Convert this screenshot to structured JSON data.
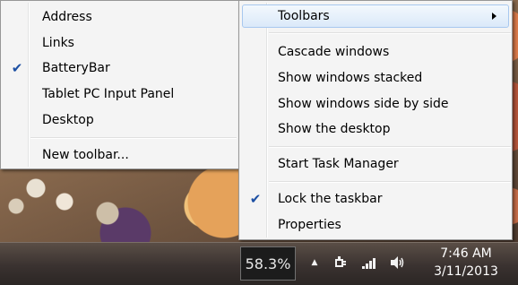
{
  "taskbar_menu": {
    "items": [
      {
        "label": "Toolbars",
        "has_submenu": true,
        "highlighted": true
      },
      {
        "label": "Cascade windows"
      },
      {
        "label": "Show windows stacked"
      },
      {
        "label": "Show windows side by side"
      },
      {
        "label": "Show the desktop"
      },
      {
        "label": "Start Task Manager"
      },
      {
        "label": "Lock the taskbar",
        "checked": true
      },
      {
        "label": "Properties"
      }
    ]
  },
  "toolbars_submenu": {
    "items": [
      {
        "label": "Address"
      },
      {
        "label": "Links"
      },
      {
        "label": "BatteryBar",
        "checked": true
      },
      {
        "label": "Tablet PC Input Panel"
      },
      {
        "label": "Desktop"
      },
      {
        "label": "New toolbar..."
      }
    ]
  },
  "taskbar": {
    "battery_percent": "58.3%",
    "time": "7:46 AM",
    "date": "3/11/2013"
  },
  "icons": {
    "check": "✔",
    "tray_up_arrow": "▲",
    "power": "power-plug-icon",
    "network": "signal-bars-icon",
    "volume": "speaker-icon"
  },
  "colors": {
    "checkmark": "#1c4fa3",
    "highlight_border": "#a8c8ef"
  }
}
